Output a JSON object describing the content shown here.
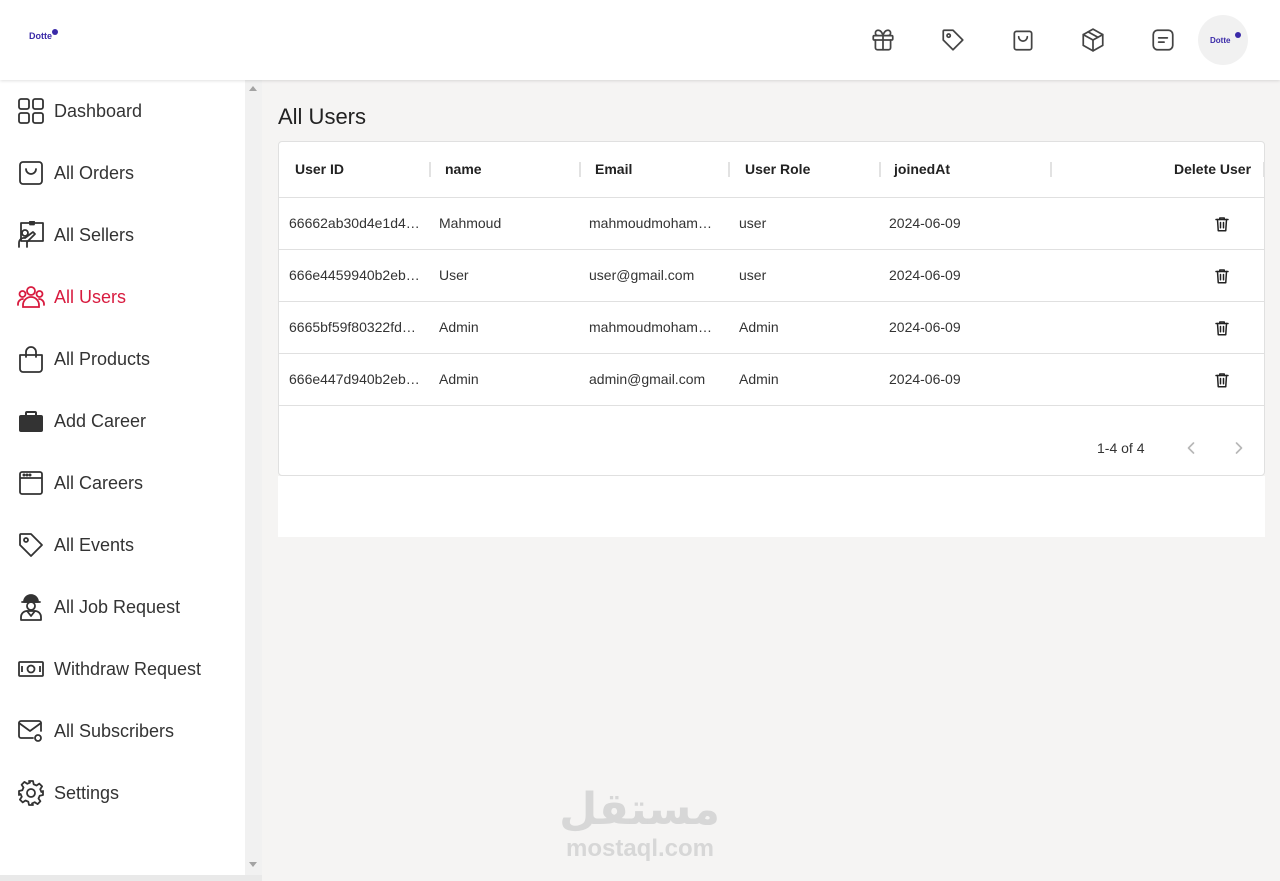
{
  "brand": {
    "logo_text": "Dotte",
    "avatar_text": "Dotte",
    "accent": "#3a2aa8"
  },
  "top_icons": [
    "gift-icon",
    "tag-icon",
    "shopping-bag-icon",
    "package-icon",
    "notes-icon"
  ],
  "sidebar": {
    "active_color": "#d81b3f",
    "items": [
      {
        "label": "Dashboard",
        "icon": "dashboard-grid-icon"
      },
      {
        "label": "All Orders",
        "icon": "shopping-bag-icon"
      },
      {
        "label": "All Sellers",
        "icon": "seller-board-icon"
      },
      {
        "label": "All Users",
        "icon": "users-group-icon",
        "active": true
      },
      {
        "label": "All Products",
        "icon": "handbag-icon"
      },
      {
        "label": "Add Career",
        "icon": "briefcase-icon"
      },
      {
        "label": "All Careers",
        "icon": "window-icon"
      },
      {
        "label": "All Events",
        "icon": "tag-icon"
      },
      {
        "label": "All Job Request",
        "icon": "worker-icon"
      },
      {
        "label": "Withdraw Request",
        "icon": "money-icon"
      },
      {
        "label": "All Subscribers",
        "icon": "mail-icon"
      },
      {
        "label": "Settings",
        "icon": "gear-icon"
      }
    ]
  },
  "main": {
    "title": "All Users",
    "columns": [
      "User ID",
      "name",
      "Email",
      "User Role",
      "joinedAt",
      "Delete User"
    ],
    "rows": [
      {
        "id": "66662ab30d4e1d4…",
        "name": "Mahmoud",
        "email": "mahmoudmoham…",
        "role": "user",
        "joined": "2024-06-09"
      },
      {
        "id": "666e4459940b2eb…",
        "name": "User",
        "email": "user@gmail.com",
        "role": "user",
        "joined": "2024-06-09"
      },
      {
        "id": "6665bf59f80322fd…",
        "name": "Admin",
        "email": "mahmoudmoham…",
        "role": "Admin",
        "joined": "2024-06-09"
      },
      {
        "id": "666e447d940b2eb…",
        "name": "Admin",
        "email": "admin@gmail.com",
        "role": "Admin",
        "joined": "2024-06-09"
      }
    ],
    "pagination": {
      "range": "1-4 of 4"
    }
  },
  "watermark": {
    "arabic": "مستقل",
    "latin": "mostaql.com"
  }
}
